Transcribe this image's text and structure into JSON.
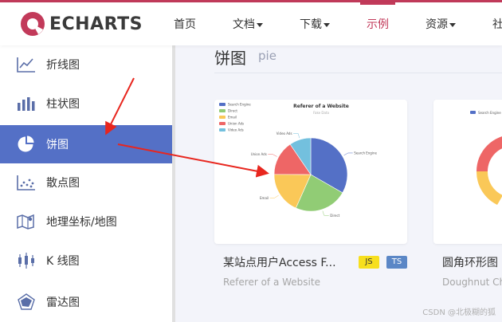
{
  "header": {
    "logo_text": "ECHARTS",
    "nav": [
      {
        "label": "首页",
        "dropdown": false,
        "active": false
      },
      {
        "label": "文档",
        "dropdown": true,
        "active": false
      },
      {
        "label": "下载",
        "dropdown": true,
        "active": false
      },
      {
        "label": "示例",
        "dropdown": false,
        "active": true
      },
      {
        "label": "资源",
        "dropdown": true,
        "active": false
      },
      {
        "label": "社",
        "dropdown": false,
        "active": false
      }
    ]
  },
  "sidebar": {
    "items": [
      {
        "label": "折线图",
        "icon": "line-chart-icon"
      },
      {
        "label": "柱状图",
        "icon": "bar-chart-icon"
      },
      {
        "label": "饼图",
        "icon": "pie-chart-icon",
        "active": true
      },
      {
        "label": "散点图",
        "icon": "scatter-chart-icon"
      },
      {
        "label": "地理坐标/地图",
        "icon": "map-icon"
      },
      {
        "label": "K 线图",
        "icon": "candlestick-icon"
      },
      {
        "label": "雷达图",
        "icon": "radar-icon"
      }
    ]
  },
  "main": {
    "title": "饼图",
    "subtitle": "pie",
    "cards": [
      {
        "title": "某站点用户Access F...",
        "subtitle": "Referer of a Website",
        "tags": [
          "JS",
          "TS"
        ]
      },
      {
        "title": "圆角环形图",
        "subtitle": "Doughnut Ch"
      }
    ]
  },
  "chart_data": {
    "type": "pie",
    "title": "Referer of a Website",
    "subtitle": "Fake Data",
    "legend_position": "top-left",
    "series": [
      {
        "name": "Search Engine",
        "value": 1048,
        "color": "#5470c6"
      },
      {
        "name": "Direct",
        "value": 735,
        "color": "#91cc75"
      },
      {
        "name": "Email",
        "value": 580,
        "color": "#fac858"
      },
      {
        "name": "Union Ads",
        "value": 484,
        "color": "#ee6666"
      },
      {
        "name": "Video Ads",
        "value": 300,
        "color": "#73c0de"
      }
    ]
  },
  "second_chart": {
    "legend": "Search Engine"
  },
  "watermark": "CSDN @北极糊的狐",
  "colors": {
    "accent": "#c23a5a",
    "sidebar_active": "#5470c6",
    "annotation_arrow": "#e8261e"
  }
}
